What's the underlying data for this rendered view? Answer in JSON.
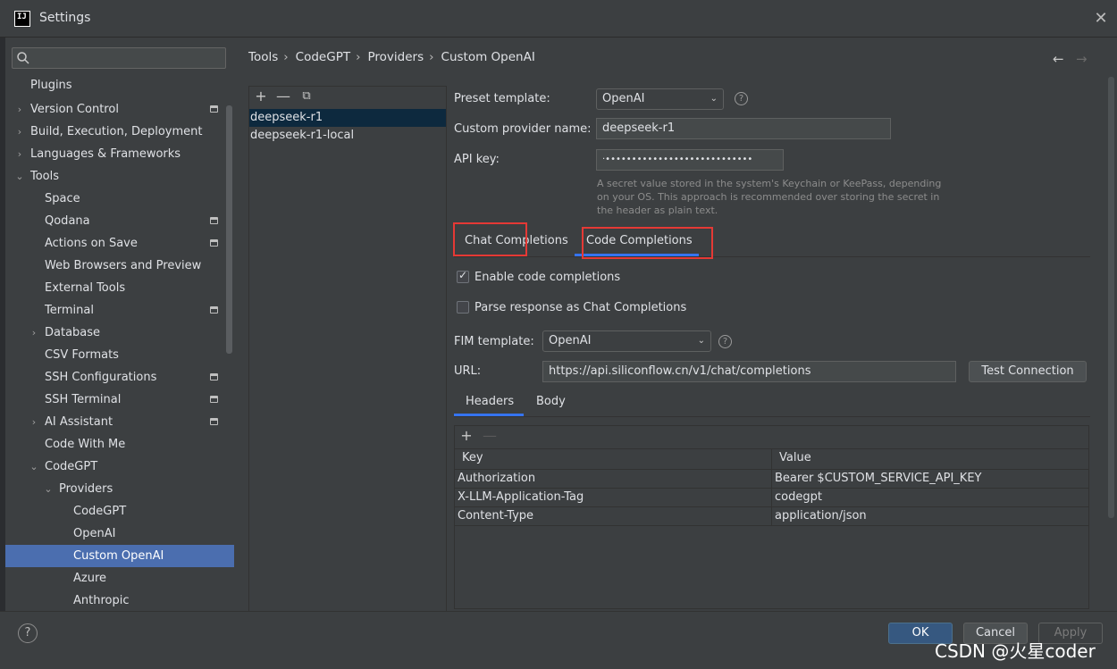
{
  "window": {
    "title": "Settings",
    "app_icon": "IJ",
    "close": "✕"
  },
  "search": {
    "placeholder": ""
  },
  "nav": {
    "items": [
      {
        "label": "Plugins"
      },
      {
        "label": "Version Control"
      },
      {
        "label": "Build, Execution, Deployment"
      },
      {
        "label": "Languages & Frameworks"
      },
      {
        "label": "Tools"
      },
      {
        "label": "Space"
      },
      {
        "label": "Qodana"
      },
      {
        "label": "Actions on Save"
      },
      {
        "label": "Web Browsers and Preview"
      },
      {
        "label": "External Tools"
      },
      {
        "label": "Terminal"
      },
      {
        "label": "Database"
      },
      {
        "label": "CSV Formats"
      },
      {
        "label": "SSH Configurations"
      },
      {
        "label": "SSH Terminal"
      },
      {
        "label": "AI Assistant"
      },
      {
        "label": "Code With Me"
      },
      {
        "label": "CodeGPT"
      },
      {
        "label": "Providers"
      },
      {
        "label": "CodeGPT"
      },
      {
        "label": "OpenAI"
      },
      {
        "label": "Custom OpenAI"
      },
      {
        "label": "Azure"
      },
      {
        "label": "Anthropic"
      }
    ],
    "selected": "Custom OpenAI"
  },
  "breadcrumb": [
    "Tools",
    "CodeGPT",
    "Providers",
    "Custom OpenAI"
  ],
  "breadcrumb_sep": "›",
  "nav_arrows": {
    "back": "←",
    "forward": "→"
  },
  "providers": {
    "toolbar": {
      "add": "+",
      "remove": "—",
      "copy": "⧉"
    },
    "items": [
      "deepseek-r1",
      "deepseek-r1-local"
    ],
    "selected": "deepseek-r1"
  },
  "form": {
    "preset_label": "Preset template:",
    "preset_value": "OpenAI",
    "name_label": "Custom provider name:",
    "name_value": "deepseek-r1",
    "apikey_label": "API key:",
    "apikey_value": "·••••••••••••••••••••••••••••",
    "hint": "A secret value stored in the system's Keychain or KeePass, depending on your OS. This approach is recommended over storing the secret in the header as plain text.",
    "tabs": [
      "Chat Completions",
      "Code Completions"
    ],
    "active_tab": "Code Completions",
    "enable_code_label": "Enable code completions",
    "enable_code_checked": true,
    "parse_label": "Parse response as Chat Completions",
    "parse_checked": false,
    "fim_label": "FIM template:",
    "fim_value": "OpenAI",
    "url_label": "URL:",
    "url_value": "https://api.siliconflow.cn/v1/chat/completions",
    "test_button": "Test Connection",
    "subtabs": [
      "Headers",
      "Body"
    ],
    "active_subtab": "Headers"
  },
  "headers_table": {
    "toolbar": {
      "add": "+",
      "remove": "—"
    },
    "columns": [
      "Key",
      "Value"
    ],
    "rows": [
      {
        "key": "Authorization",
        "value": "Bearer $CUSTOM_SERVICE_API_KEY"
      },
      {
        "key": "X-LLM-Application-Tag",
        "value": "codegpt"
      },
      {
        "key": "Content-Type",
        "value": "application/json"
      }
    ]
  },
  "footer": {
    "help": "?",
    "ok": "OK",
    "cancel": "Cancel",
    "apply": "Apply"
  },
  "watermark": "CSDN @火星coder",
  "colors": {
    "accent": "#3574f0",
    "selection": "#4b6eaf",
    "highlight_box": "#e53935"
  }
}
